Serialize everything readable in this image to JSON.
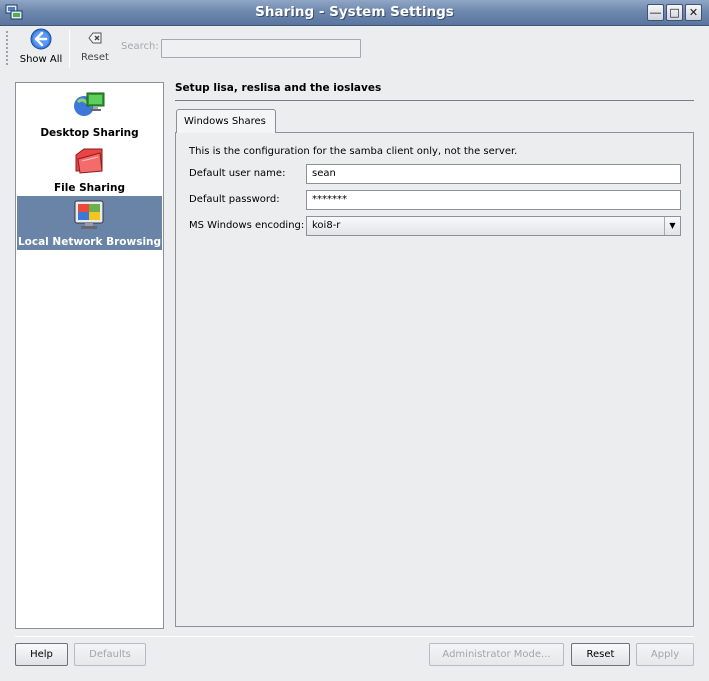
{
  "window": {
    "title": "Sharing - System Settings",
    "controls": [
      "minimize",
      "maximize",
      "close"
    ]
  },
  "toolbar": {
    "show_all_label": "Show All",
    "reset_label": "Reset",
    "search_label": "Search:",
    "search_value": ""
  },
  "sidebar": {
    "items": [
      {
        "label": "Desktop Sharing",
        "icon": "desktop-sharing-icon",
        "selected": false
      },
      {
        "label": "File Sharing",
        "icon": "folder-icon",
        "selected": false
      },
      {
        "label": "Local Network Browsing",
        "icon": "network-monitor-icon",
        "selected": true
      }
    ]
  },
  "main": {
    "title": "Setup lisa, reslisa and the ioslaves",
    "tabs": [
      {
        "label": "Windows Shares",
        "active": true
      }
    ],
    "note": "This is the configuration for the samba client only, not the server.",
    "fields": {
      "user_label": "Default user name:",
      "user_value": "sean",
      "password_label": "Default password:",
      "password_value": "*******",
      "encoding_label": "MS Windows encoding:",
      "encoding_value": "koi8-r"
    }
  },
  "buttons": {
    "help": "Help",
    "defaults": "Defaults",
    "admin_mode": "Administrator Mode...",
    "reset": "Reset",
    "apply": "Apply"
  },
  "colors": {
    "titlebar": "#6e88ad",
    "selection": "#6a84a8",
    "background": "#ecedee"
  }
}
